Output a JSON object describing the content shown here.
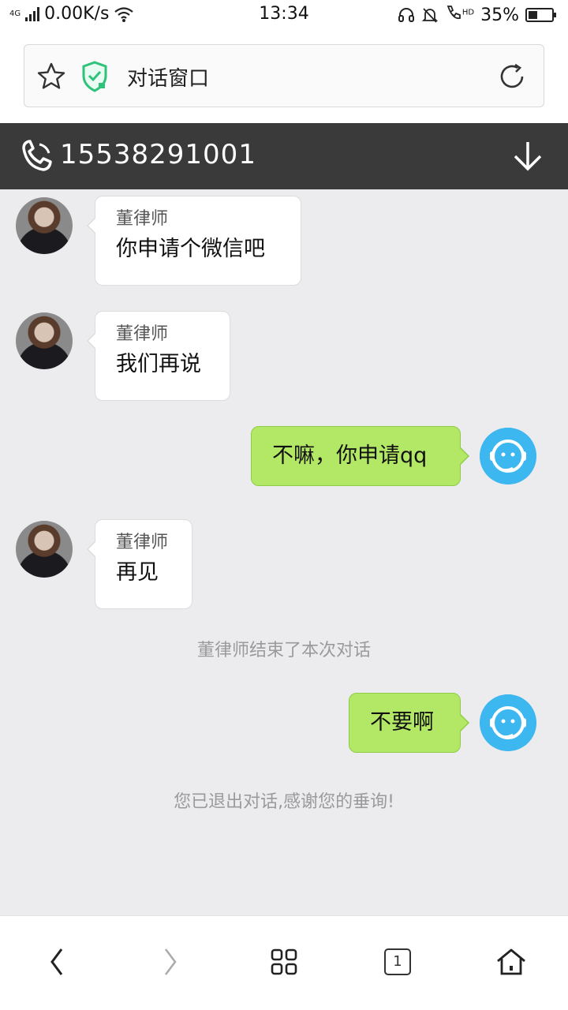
{
  "status_bar": {
    "network": "4G",
    "speed": "0.00K/s",
    "time": "13:34",
    "hd_label": "HD",
    "battery": "35%"
  },
  "address_bar": {
    "title": "对话窗口",
    "star_icon": "star-icon",
    "shield_icon": "shield-check-icon",
    "refresh_icon": "refresh-icon"
  },
  "chat_header": {
    "phone_number": "15538291001",
    "phone_icon": "phone-icon",
    "down_icon": "arrow-down-icon",
    "background": "#3a3a3a"
  },
  "messages": [
    {
      "side": "left",
      "sender": "董律师",
      "text": "你申请个微信吧"
    },
    {
      "side": "left",
      "sender": "董律师",
      "text": "我们再说"
    },
    {
      "side": "right",
      "text": "不嘛，你申请qq"
    },
    {
      "side": "left",
      "sender": "董律师",
      "text": "再见"
    },
    {
      "side": "system",
      "text": "董律师结束了本次对话"
    },
    {
      "side": "right",
      "text": "不要啊"
    },
    {
      "side": "system",
      "text": "您已退出对话,感谢您的垂询!"
    }
  ],
  "bottom_nav": {
    "tab_count": "1",
    "icons": [
      "back-icon",
      "forward-icon",
      "grid-menu-icon",
      "tabs-icon",
      "home-icon"
    ]
  },
  "colors": {
    "chat_background": "#ecebee",
    "outgoing_bubble": "#b3e866",
    "agent_avatar": "#3db7ef"
  }
}
